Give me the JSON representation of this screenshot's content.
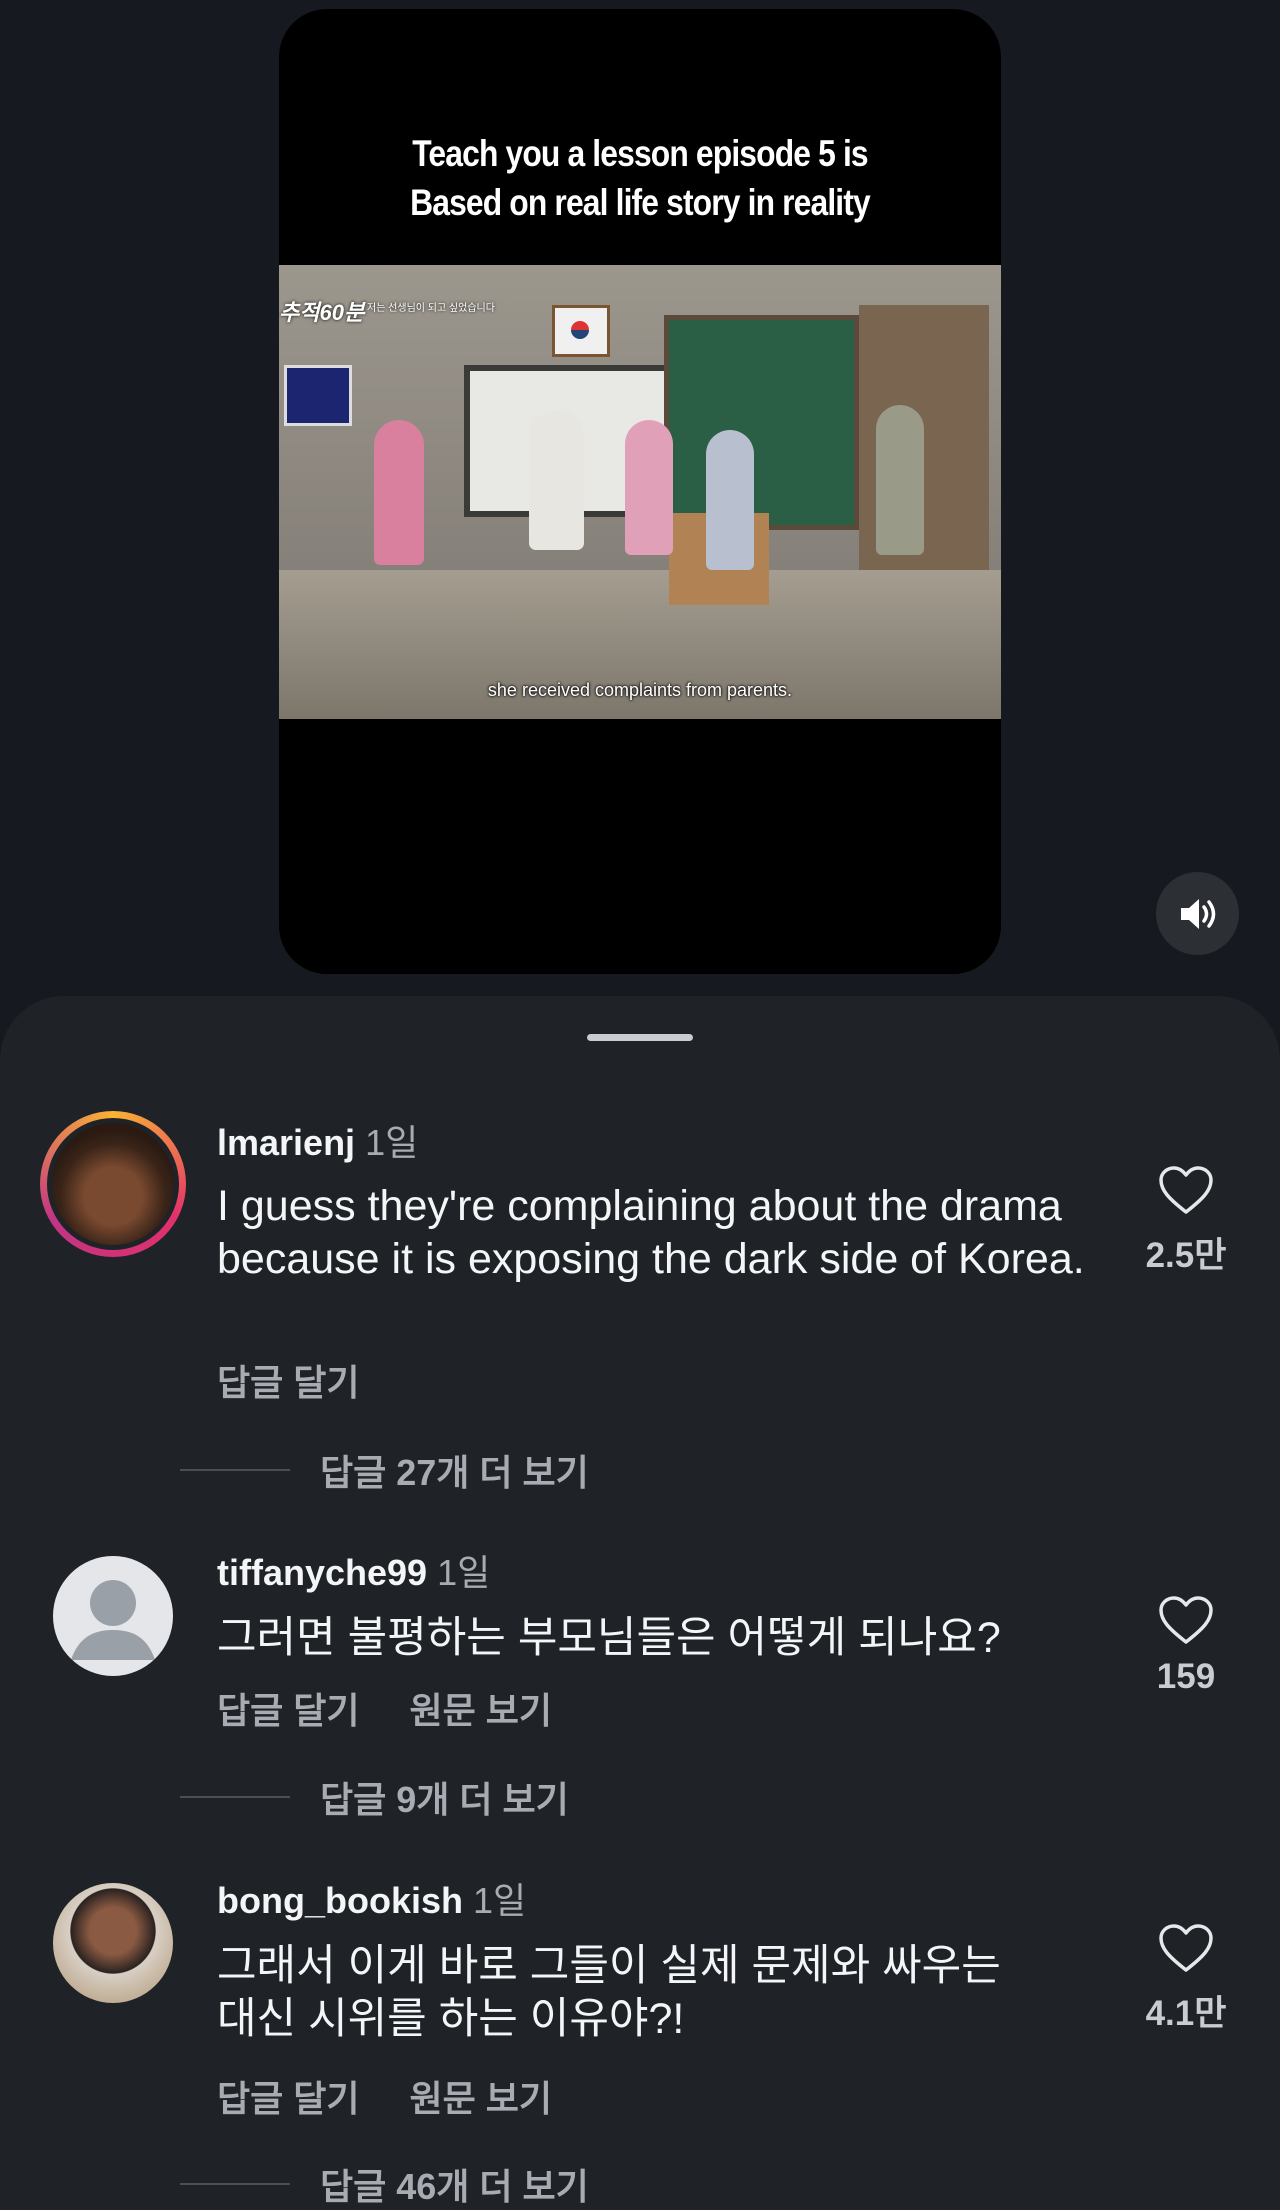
{
  "video": {
    "caption_line1": "Teach you a lesson episode 5 is",
    "caption_line2": "Based on real life story in reality",
    "frame_logo": "추적60분",
    "frame_logo_sub": "저는 선생님이 되고 싶었습니다",
    "frame_subtitle": "she received complaints from parents.",
    "sound_icon": "speaker-icon"
  },
  "comments": [
    {
      "username": "lmarienj",
      "time": "1일",
      "text": "I guess they're complaining about the drama because it is exposing the dark side of Korea.",
      "reply_label": "답글 달기",
      "translate_label": "",
      "likes": "2.5만",
      "more_replies": "답글 27개 더 보기"
    },
    {
      "username": "tiffanyche99",
      "time": "1일",
      "text": "그러면 불평하는 부모님들은 어떻게 되나요?",
      "reply_label": "답글 달기",
      "translate_label": "원문 보기",
      "likes": "159",
      "more_replies": "답글 9개 더 보기"
    },
    {
      "username": "bong_bookish",
      "time": "1일",
      "text": "그래서 이게 바로 그들이 실제 문제와 싸우는 대신 시위를 하는 이유야?!",
      "reply_label": "답글 달기",
      "translate_label": "원문 보기",
      "likes": "4.1만",
      "more_replies": "답글 46개 더 보기"
    }
  ],
  "colors": {
    "background": "#161a20",
    "sheet": "#1f2226",
    "muted_text": "#a8acb2",
    "story_ring_start": "#f9b234",
    "story_ring_end": "#c13584"
  }
}
